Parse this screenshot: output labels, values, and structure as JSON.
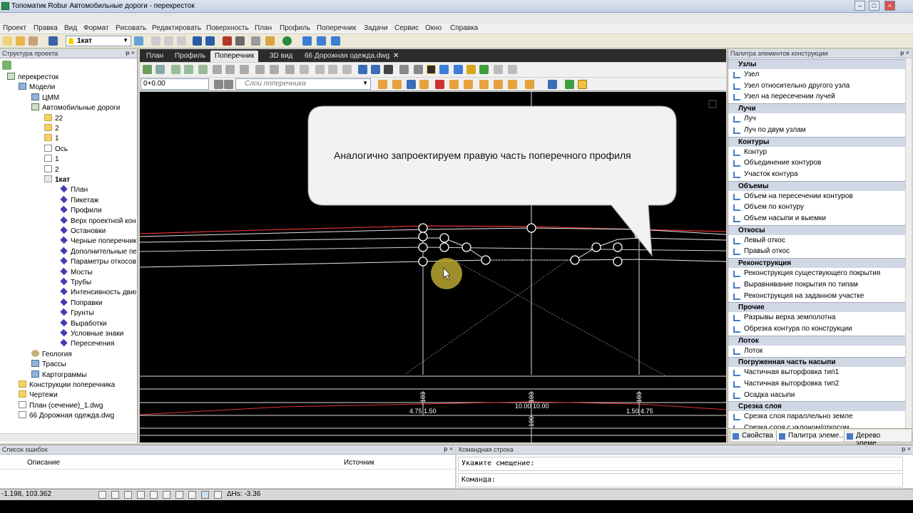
{
  "window": {
    "title": "Топоматик Robur Автомобильные дороги - перекресток"
  },
  "menu": [
    "Проект",
    "Правка",
    "Вид",
    "Формат",
    "Рисовать",
    "Редактировать",
    "Поверхность",
    "План",
    "Профиль",
    "Поперечник",
    "Задачи",
    "Сервис",
    "Окно",
    "Справка"
  ],
  "toolbar": {
    "layer_value": "1кат"
  },
  "left_panel": {
    "title": "Структура проекта",
    "tree": [
      {
        "label": "перекресток",
        "icon": "project-icon",
        "level": 0
      },
      {
        "label": "Модели",
        "icon": "models-icon",
        "level": 1
      },
      {
        "label": "ЦММ",
        "icon": "dtm-icon",
        "level": 2
      },
      {
        "label": "Автомобильные дороги",
        "icon": "roads-icon",
        "level": 2
      },
      {
        "label": "22",
        "icon": "folder-icon",
        "level": 3
      },
      {
        "label": "2",
        "icon": "folder-icon",
        "level": 3
      },
      {
        "label": "1",
        "icon": "folder-icon",
        "level": 3
      },
      {
        "label": "Ось",
        "icon": "document-icon",
        "level": 3
      },
      {
        "label": "1",
        "icon": "document-icon",
        "level": 3
      },
      {
        "label": "2",
        "icon": "document-icon",
        "level": 3
      },
      {
        "label": "1кат",
        "icon": "selected-document-icon",
        "level": 3
      },
      {
        "label": "План",
        "icon": "diamond-icon",
        "level": 4
      },
      {
        "label": "Пикетаж",
        "icon": "diamond-icon",
        "level": 4
      },
      {
        "label": "Профили",
        "icon": "diamond-icon",
        "level": 4
      },
      {
        "label": "Верх проектной конс",
        "icon": "diamond-icon",
        "level": 4
      },
      {
        "label": "Остановки",
        "icon": "diamond-icon",
        "level": 4
      },
      {
        "label": "Черные поперечник",
        "icon": "diamond-icon",
        "level": 4
      },
      {
        "label": "Дополнительные пер",
        "icon": "diamond-icon",
        "level": 4
      },
      {
        "label": "Параметры откосов",
        "icon": "diamond-icon",
        "level": 4
      },
      {
        "label": "Мосты",
        "icon": "diamond-icon",
        "level": 4
      },
      {
        "label": "Трубы",
        "icon": "diamond-icon",
        "level": 4
      },
      {
        "label": "Интенсивность движ",
        "icon": "diamond-icon",
        "level": 4
      },
      {
        "label": "Поправки",
        "icon": "diamond-icon",
        "level": 4
      },
      {
        "label": "Грунты",
        "icon": "diamond-icon",
        "level": 4
      },
      {
        "label": "Выработки",
        "icon": "diamond-icon",
        "level": 4
      },
      {
        "label": "Условные знаки",
        "icon": "diamond-icon",
        "level": 4
      },
      {
        "label": "Пересечения",
        "icon": "diamond-icon",
        "level": 4
      },
      {
        "label": "Геология",
        "icon": "geology-icon",
        "level": 2
      },
      {
        "label": "Трассы",
        "icon": "routes-icon",
        "level": 2
      },
      {
        "label": "Картограммы",
        "icon": "cartogram-icon",
        "level": 2
      },
      {
        "label": "Конструкции поперечника",
        "icon": "folder-icon",
        "level": 1
      },
      {
        "label": "Чертежи",
        "icon": "folder-icon",
        "level": 1
      },
      {
        "label": "План (сечение)_1.dwg",
        "icon": "document-icon",
        "level": 1
      },
      {
        "label": "66 Дорожная одежда.dwg",
        "icon": "document-icon",
        "level": 1
      }
    ]
  },
  "tabs": [
    "План",
    "Профиль",
    "Поперечник",
    "3D вид",
    "66 Дорожная одежда.dwg"
  ],
  "active_tab": "Поперечник",
  "cross_section_toolbar": {
    "station_value": "0+0.00",
    "layers_placeholder": "Слои поперечника"
  },
  "callout": {
    "text": "Аналогично запроектируем правую часть поперечного профиля"
  },
  "drawing_labels": {
    "left_mark": "103",
    "center_mark": "103",
    "right_mark": "103",
    "left_widths": "4.75 1.50",
    "center_widths": "10.00 10.00",
    "right_widths": "1.50 4.75",
    "bottom_mark": "100"
  },
  "right_panel": {
    "title": "Палитра элементов конструкции",
    "groups": [
      {
        "name": "Узлы",
        "items": [
          "Узел",
          "Узел относительно другого узла",
          "Узел на пересечении лучей"
        ]
      },
      {
        "name": "Лучи",
        "items": [
          "Луч",
          "Луч по двум узлам"
        ]
      },
      {
        "name": "Контуры",
        "items": [
          "Контур",
          "Объединение контуров",
          "Участок контура"
        ]
      },
      {
        "name": "Объемы",
        "items": [
          "Объем на пересечении контуров",
          "Объем по контуру",
          "Объем насыпи и выемки"
        ]
      },
      {
        "name": "Откосы",
        "items": [
          "Левый откос",
          "Правый откос"
        ]
      },
      {
        "name": "Реконструкция",
        "items": [
          "Реконструкция существующего покрытия",
          "Выравнивание покрытия по типам",
          "Реконструкция на заданном участке"
        ]
      },
      {
        "name": "Прочие",
        "items": [
          "Разрывы верха земполотна",
          "Обрезка контура по конструкции"
        ]
      },
      {
        "name": "Лоток",
        "items": [
          "Лоток"
        ]
      },
      {
        "name": "Погруженная часть насыпи",
        "items": [
          "Частичная выторфовка тип1",
          "Частичная выторфовка тип2",
          "Осадка насыпи"
        ]
      },
      {
        "name": "Срезка слоя",
        "items": [
          "Срезка слоя параллельно земле",
          "Срезка слоя с уклоном/откосом"
        ]
      }
    ],
    "tabs": [
      "Свойства",
      "Палитра элеме...",
      "Дерево элеме..."
    ]
  },
  "errors_panel": {
    "title": "Список ошибок",
    "columns": [
      "Описание",
      "Источник"
    ]
  },
  "command_panel": {
    "title": "Командная строка",
    "line1": "Укажите смещение:",
    "line2": "Команда:"
  },
  "status": {
    "coords": "-1.198, 103.362",
    "dh": "ΔHs: -3.36"
  }
}
